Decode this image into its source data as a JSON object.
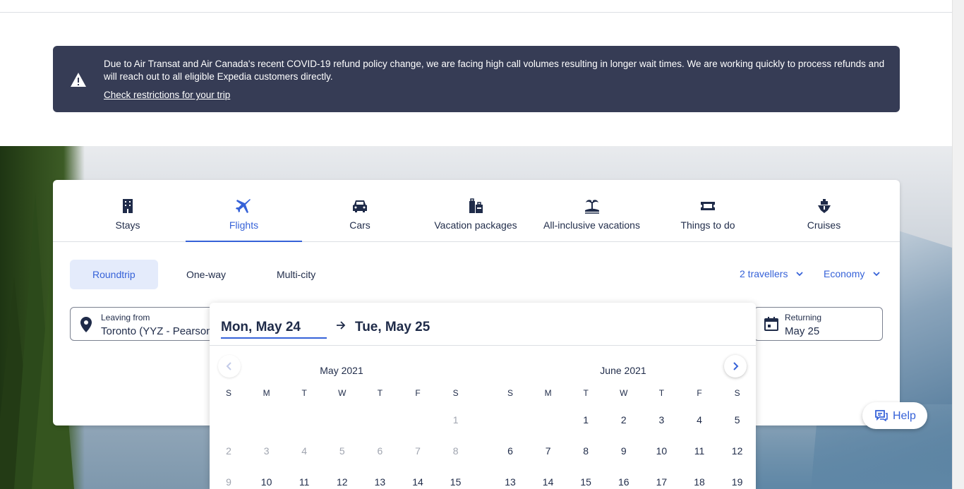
{
  "alert": {
    "message": "Due to Air Transat and Air Canada's recent COVID-19 refund policy change, we are facing high call volumes resulting in longer wait times. We are working quickly to process refunds and will reach out to all eligible Expedia customers directly.",
    "link": "Check restrictions for your trip"
  },
  "tabs": [
    {
      "label": "Stays",
      "icon": "building-icon"
    },
    {
      "label": "Flights",
      "icon": "plane-icon",
      "active": true
    },
    {
      "label": "Cars",
      "icon": "car-icon"
    },
    {
      "label": "Vacation packages",
      "icon": "luggage-icon"
    },
    {
      "label": "All-inclusive vacations",
      "icon": "island-icon"
    },
    {
      "label": "Things to do",
      "icon": "ticket-icon"
    },
    {
      "label": "Cruises",
      "icon": "ship-icon"
    }
  ],
  "trip_types": [
    "Roundtrip",
    "One-way",
    "Multi-city"
  ],
  "travellers": "2 travellers",
  "cabin": "Economy",
  "leaving": {
    "label": "Leaving from",
    "value": "Toronto (YYZ - Pearson"
  },
  "returning": {
    "label": "Returning",
    "value": "May 25"
  },
  "datepicker": {
    "start": "Mon, May 24",
    "end": "Tue, May 25",
    "weekdays": [
      "S",
      "M",
      "T",
      "W",
      "T",
      "F",
      "S"
    ],
    "months": [
      {
        "title": "May 2021",
        "rows": [
          [
            "",
            "",
            "",
            "",
            "",
            "",
            "1"
          ],
          [
            "2",
            "3",
            "4",
            "5",
            "6",
            "7",
            "8"
          ],
          [
            "9",
            "10",
            "11",
            "12",
            "13",
            "14",
            "15"
          ]
        ],
        "disabled_through": 9
      },
      {
        "title": "June 2021",
        "rows": [
          [
            "",
            "",
            "1",
            "2",
            "3",
            "4",
            "5"
          ],
          [
            "6",
            "7",
            "8",
            "9",
            "10",
            "11",
            "12"
          ],
          [
            "13",
            "14",
            "15",
            "16",
            "17",
            "18",
            "19"
          ]
        ],
        "disabled_through": 0
      }
    ]
  },
  "help": "Help",
  "colors": {
    "accent": "#3662d8",
    "alert_bg": "#363c55",
    "text": "#1f2b49"
  }
}
